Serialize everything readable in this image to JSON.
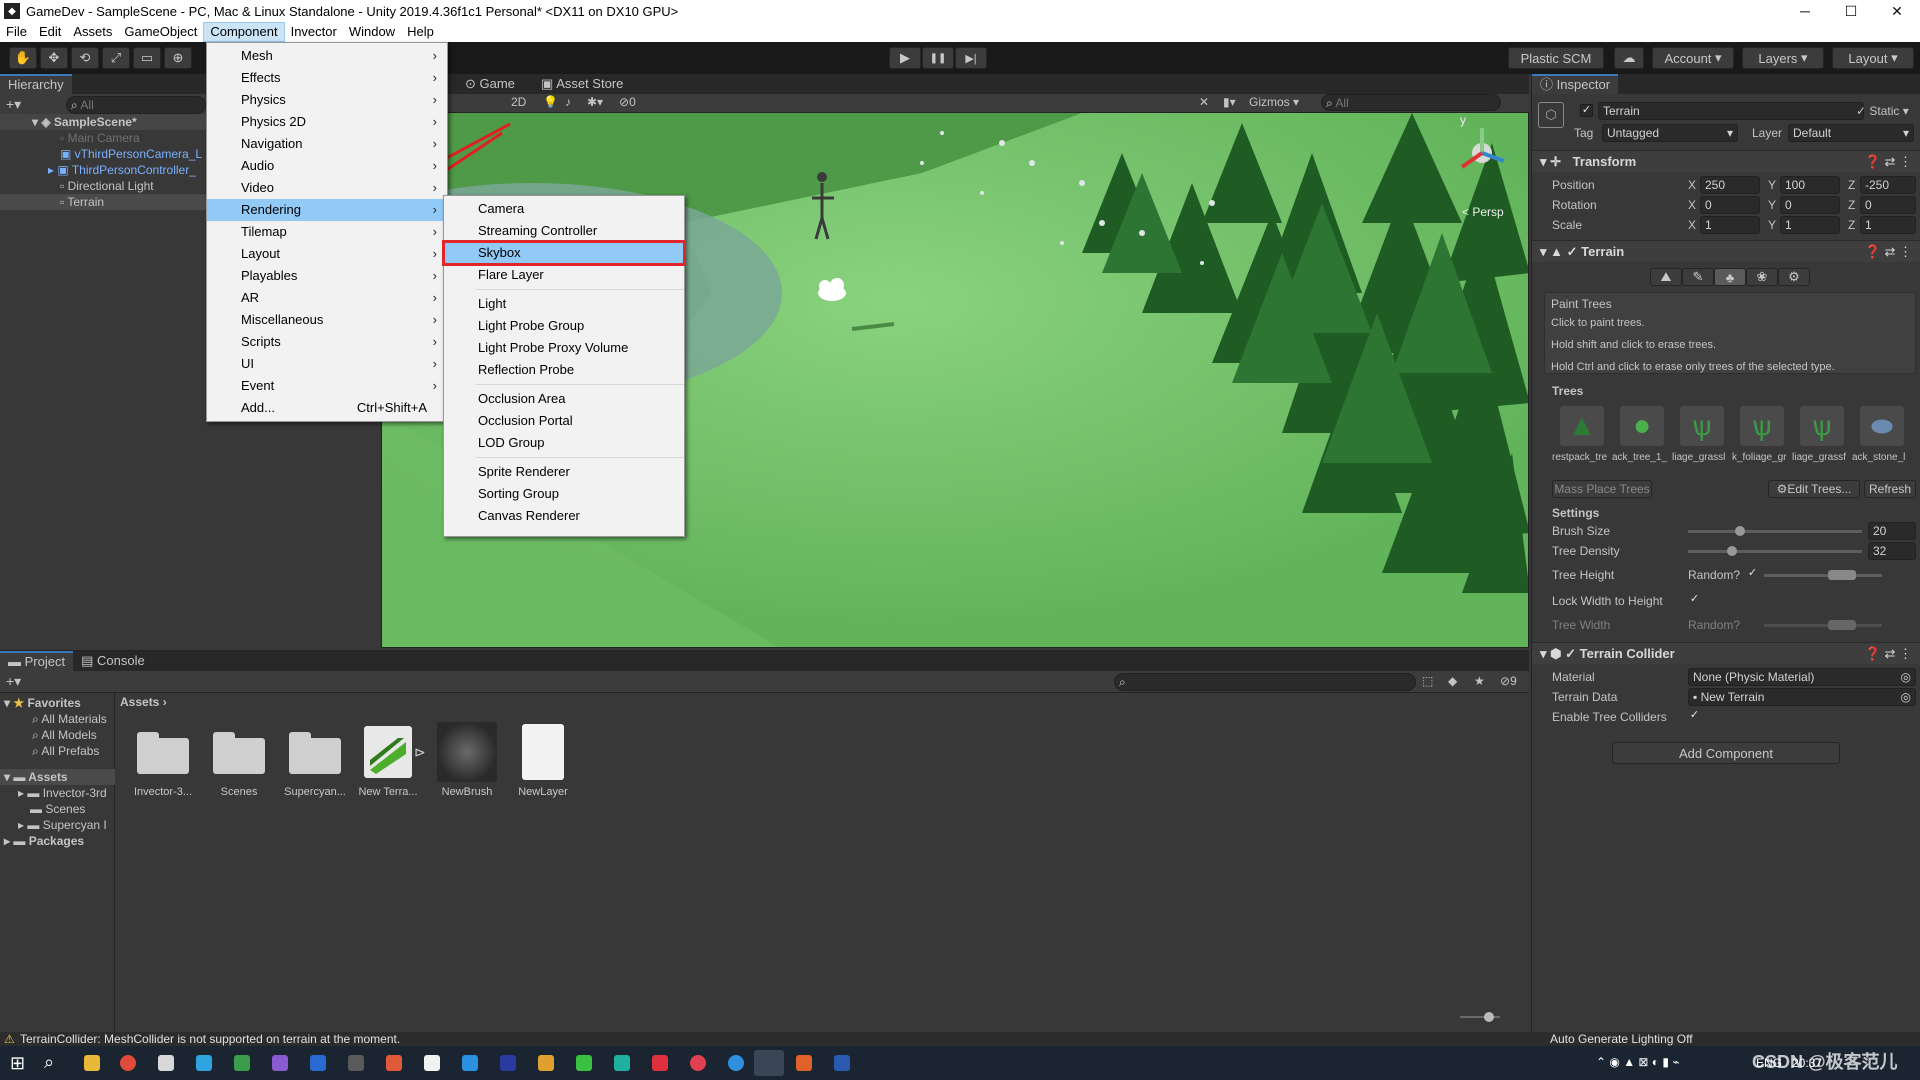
{
  "window": {
    "title": "GameDev - SampleScene - PC, Mac & Linux Standalone - Unity 2019.4.36f1c1 Personal* <DX11 on DX10 GPU>",
    "minimize": "─",
    "maximize": "☐",
    "close": "✕"
  },
  "menubar": [
    "File",
    "Edit",
    "Assets",
    "GameObject",
    "Component",
    "Invector",
    "Window",
    "Help"
  ],
  "toolbar": {
    "play": "▶",
    "pause": "❚❚",
    "step": "▶|",
    "plastic": "Plastic SCM",
    "cloud": "☁",
    "account": "Account",
    "layers": "Layers",
    "layout": "Layout"
  },
  "hierarchy": {
    "tab": "Hierarchy",
    "search": "All",
    "scene": "SampleScene*",
    "items": [
      "Main Camera",
      "vThirdPersonCamera_L",
      "ThirdPersonController_",
      "Directional Light",
      "Terrain"
    ]
  },
  "sceneview": {
    "tabs": [
      "Game",
      "Asset Store"
    ],
    "mode2d": "2D",
    "gizmos": "Gizmos",
    "search": "All",
    "fx_count": "0",
    "persp": "< Persp",
    "axis_y": "y",
    "axis_x": "x"
  },
  "component_menu": [
    {
      "label": "Mesh",
      "sub": true
    },
    {
      "label": "Effects",
      "sub": true
    },
    {
      "label": "Physics",
      "sub": true
    },
    {
      "label": "Physics 2D",
      "sub": true
    },
    {
      "label": "Navigation",
      "sub": true
    },
    {
      "label": "Audio",
      "sub": true
    },
    {
      "label": "Video",
      "sub": true
    },
    {
      "label": "Rendering",
      "sub": true,
      "hl": true
    },
    {
      "label": "Tilemap",
      "sub": true
    },
    {
      "label": "Layout",
      "sub": true
    },
    {
      "label": "Playables",
      "sub": true
    },
    {
      "label": "AR",
      "sub": true
    },
    {
      "label": "Miscellaneous",
      "sub": true
    },
    {
      "label": "Scripts",
      "sub": true
    },
    {
      "label": "UI",
      "sub": true
    },
    {
      "label": "Event",
      "sub": true
    },
    {
      "label": "Add...",
      "shortcut": "Ctrl+Shift+A"
    }
  ],
  "rendering_menu": [
    [
      "Camera",
      "Streaming Controller",
      "Skybox",
      "Flare Layer"
    ],
    [
      "Light",
      "Light Probe Group",
      "Light Probe Proxy Volume",
      "Reflection Probe"
    ],
    [
      "Occlusion Area",
      "Occlusion Portal",
      "LOD Group"
    ],
    [
      "Sprite Renderer",
      "Sorting Group",
      "Canvas Renderer"
    ]
  ],
  "inspector": {
    "tab": "Inspector",
    "object": "Terrain",
    "static": "Static",
    "tag_label": "Tag",
    "tag": "Untagged",
    "layer_label": "Layer",
    "layer": "Default",
    "transform": {
      "title": "Transform",
      "rows": [
        {
          "label": "Position",
          "x": "250",
          "y": "100",
          "z": "-250"
        },
        {
          "label": "Rotation",
          "x": "0",
          "y": "0",
          "z": "0"
        },
        {
          "label": "Scale",
          "x": "1",
          "y": "1",
          "z": "1"
        }
      ]
    },
    "terrain": {
      "title": "Terrain",
      "paint_title": "Paint Trees",
      "help": [
        "Click to paint trees.",
        "Hold shift and click to erase trees.",
        "Hold Ctrl and click to erase only trees of the selected type."
      ],
      "trees_title": "Trees",
      "tree_names": [
        "restpack_tre",
        "ack_tree_1_",
        "liage_grassl",
        "k_foliage_gr",
        "liage_grassf",
        "ack_stone_l"
      ],
      "mass_place": "Mass Place Trees",
      "edit_trees": "⚙Edit Trees...",
      "refresh": "Refresh",
      "settings_title": "Settings",
      "brush_size_label": "Brush Size",
      "brush_size": "20",
      "brush_size_level": 0.3,
      "tree_density_label": "Tree Density",
      "tree_density": "32",
      "tree_density_level": 0.25,
      "tree_height_label": "Tree Height",
      "random": "Random?",
      "lock_label": "Lock Width to Height",
      "tree_width_label": "Tree Width"
    },
    "collider": {
      "title": "Terrain Collider",
      "material_label": "Material",
      "material": "None (Physic Material)",
      "data_label": "Terrain Data",
      "data": "New Terrain",
      "enable_label": "Enable Tree Colliders"
    },
    "add_component": "Add Component"
  },
  "project": {
    "tabs": [
      "Project",
      "Console"
    ],
    "favorites": "Favorites",
    "fav_items": [
      "All Materials",
      "All Models",
      "All Prefabs"
    ],
    "assets": "Assets",
    "asset_folders": [
      "Invector-3rd",
      "Scenes",
      "Supercyan I"
    ],
    "packages": "Packages",
    "breadcrumb": "Assets",
    "hidden_count": "9",
    "items": [
      "Invector-3...",
      "Scenes",
      "Supercyan...",
      "New Terra...",
      "NewBrush",
      "NewLayer"
    ]
  },
  "status": {
    "warning": "TerrainCollider: MeshCollider is not supported on terrain at the moment.",
    "lighting": "Auto Generate Lighting Off"
  },
  "taskbar": {
    "tray": "ENG",
    "time": "20:37",
    "watermark": "CSDN @极客范儿"
  }
}
